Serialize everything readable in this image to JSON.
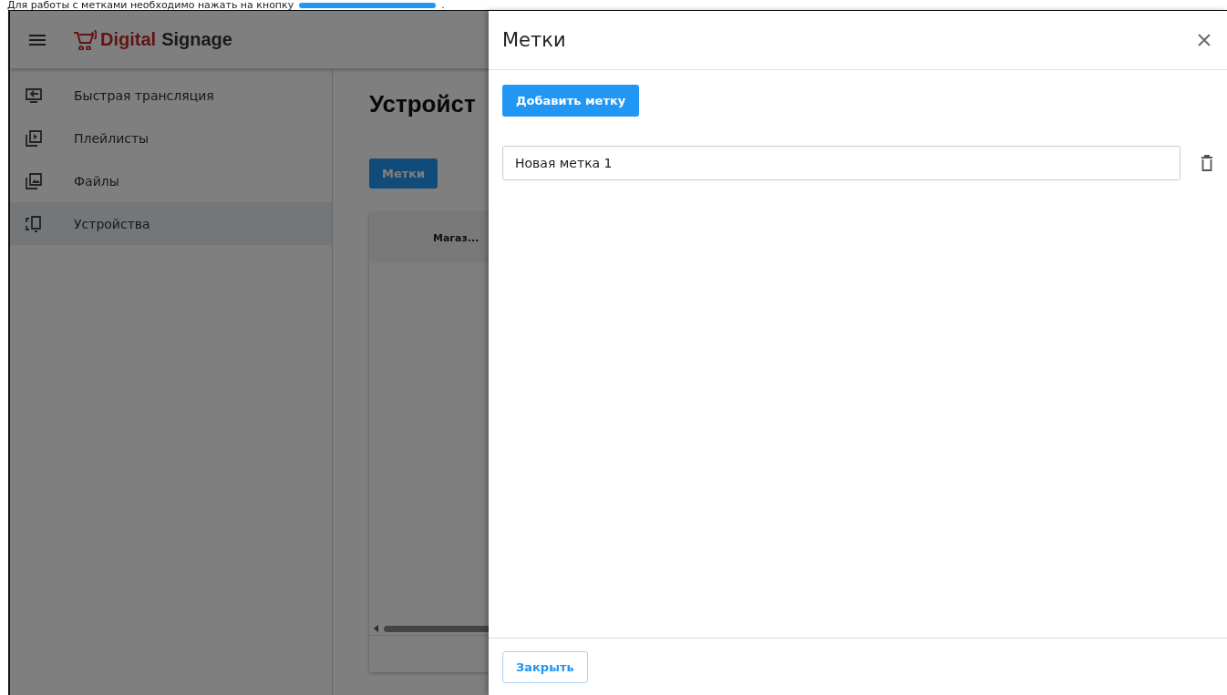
{
  "doc_line": {
    "text": "Для работы с метками необходимо нажать на кнопку",
    "tail": "."
  },
  "app_bar": {
    "logo_primary": "Digital",
    "logo_secondary": "Signage"
  },
  "sidebar": {
    "items": [
      {
        "label": "Быстрая трансляция",
        "kind": "cast",
        "selected": false
      },
      {
        "label": "Плейлисты",
        "kind": "playlist",
        "selected": false
      },
      {
        "label": "Файлы",
        "kind": "images",
        "selected": false
      },
      {
        "label": "Устройства",
        "kind": "devices",
        "selected": true
      }
    ]
  },
  "page": {
    "title": "Устройст",
    "tags_button": "Метки",
    "table": {
      "columns": [
        "Магаз..."
      ]
    }
  },
  "drawer": {
    "title": "Метки",
    "add_button": "Добавить метку",
    "tags": [
      {
        "value": "Новая метка 1"
      }
    ],
    "close_button": "Закрыть"
  }
}
